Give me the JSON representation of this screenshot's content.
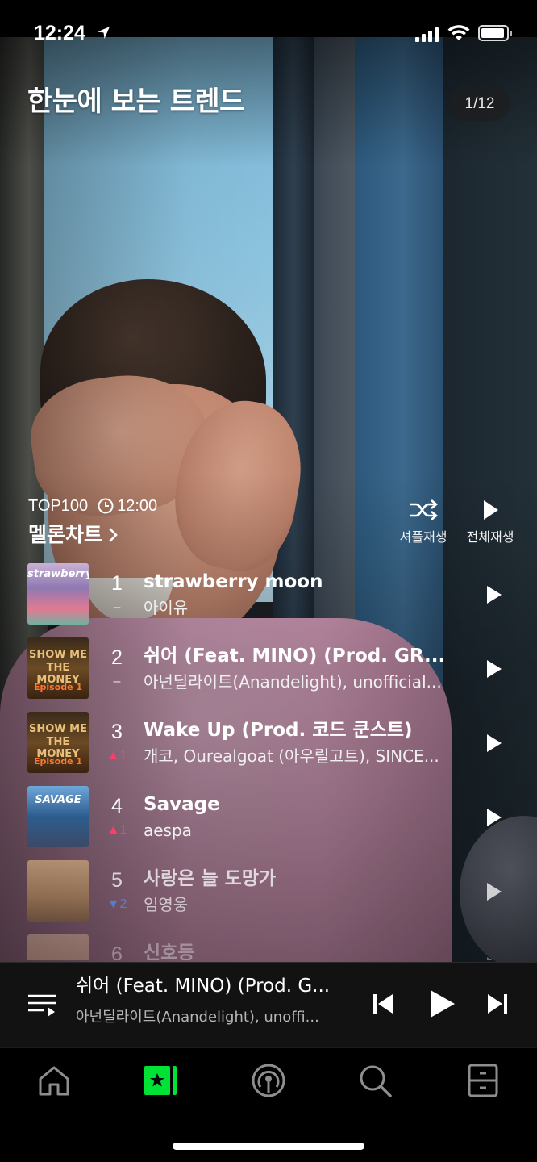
{
  "status_bar": {
    "time": "12:24"
  },
  "header": {
    "title": "한눈에 보는 트렌드",
    "page_indicator": "1/12"
  },
  "chart": {
    "label": "TOP100",
    "time": "12:00",
    "name": "멜론차트",
    "shuffle_label": "셔플재생",
    "play_all_label": "전체재생",
    "items": [
      {
        "rank": "1",
        "change": "–",
        "change_dir": "same",
        "title": "strawberry moon",
        "artist": "아이유"
      },
      {
        "rank": "2",
        "change": "–",
        "change_dir": "same",
        "title": "쉬어 (Feat. MINO) (Prod. GR...",
        "artist": "아넌딜라이트(Anandelight), unofficial..."
      },
      {
        "rank": "3",
        "change": "1",
        "change_dir": "up",
        "title": "Wake Up (Prod. 코드 쿤스트)",
        "artist": "개코, Ourealgoat (아우릴고트), SINCE..."
      },
      {
        "rank": "4",
        "change": "1",
        "change_dir": "up",
        "title": "Savage",
        "artist": "aespa"
      },
      {
        "rank": "5",
        "change": "2",
        "change_dir": "down",
        "title": "사랑은 늘 도망가",
        "artist": "임영웅"
      },
      {
        "rank": "6",
        "change": "",
        "change_dir": "same",
        "title": "신호등",
        "artist": ""
      }
    ]
  },
  "player": {
    "title": "쉬어 (Feat. MINO) (Prod. G...",
    "artist": "아넌딜라이트(Anandelight), unoffi..."
  },
  "tabs": [
    {
      "icon": "home-icon"
    },
    {
      "icon": "chart-icon",
      "active": true
    },
    {
      "icon": "podcast-icon"
    },
    {
      "icon": "search-icon"
    },
    {
      "icon": "library-icon"
    }
  ],
  "colors": {
    "accent": "#00e335",
    "rank_up": "#ff3d6a",
    "rank_down": "#4f8cff"
  }
}
